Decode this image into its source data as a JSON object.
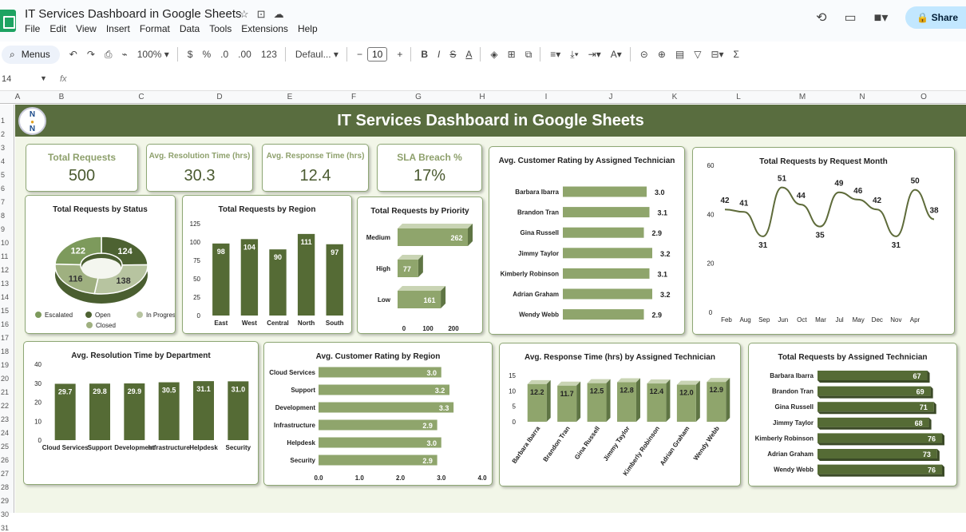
{
  "app": {
    "doc_title": "IT Services Dashboard in Google Sheets",
    "menu": [
      "File",
      "Edit",
      "View",
      "Insert",
      "Format",
      "Data",
      "Tools",
      "Extensions",
      "Help"
    ],
    "share_label": "Share",
    "name_box": "14",
    "fx_label": "fx"
  },
  "toolbar": {
    "menus_label": "Menus",
    "zoom": "100%",
    "currency": "$",
    "percent": "%",
    "dec_down": ".0",
    "dec_up": ".00",
    "number_format": "123",
    "font": "Defaul...",
    "font_size": "10"
  },
  "columns": [
    "A",
    "B",
    "C",
    "D",
    "E",
    "F",
    "G",
    "H",
    "I",
    "J",
    "K",
    "L",
    "M",
    "N",
    "O"
  ],
  "rows": [
    "1",
    "2",
    "3",
    "4",
    "5",
    "6",
    "7",
    "8",
    "9",
    "10",
    "11",
    "12",
    "13",
    "14",
    "15",
    "16",
    "17",
    "18",
    "19",
    "20",
    "21",
    "22",
    "23",
    "24",
    "25",
    "26",
    "27",
    "28",
    "29",
    "30",
    "31"
  ],
  "dashboard": {
    "title": "IT Services Dashboard in Google Sheets",
    "logo_letters": [
      "N",
      "●",
      "N"
    ],
    "colors": {
      "dark": "#556b35",
      "light": "#8fa56c",
      "pale": "#b9c69f",
      "banner": "#596d3f"
    },
    "kpis": [
      {
        "label": "Total Requests",
        "value": "500"
      },
      {
        "label": "Avg. Resolution Time (hrs)",
        "value": "30.3"
      },
      {
        "label": "Avg. Response Time (hrs)",
        "value": "12.4"
      },
      {
        "label": "SLA Breach %",
        "value": "17%"
      }
    ]
  },
  "chart_data": [
    {
      "id": "status",
      "type": "pie",
      "title": "Total Requests  by Status",
      "categories": [
        "Escalated",
        "Open",
        "In Progress",
        "Closed"
      ],
      "values": [
        122,
        124,
        138,
        116
      ],
      "colors": [
        "#7d9a5c",
        "#4d6232",
        "#b7c4a0",
        "#9fb080"
      ]
    },
    {
      "id": "region",
      "type": "bar",
      "title": "Total Requests  by Region",
      "categories": [
        "East",
        "West",
        "Central",
        "North",
        "South"
      ],
      "values": [
        98,
        104,
        90,
        111,
        97
      ],
      "ylim": [
        0,
        125
      ],
      "yticks": [
        0,
        25,
        50,
        75,
        100,
        125
      ]
    },
    {
      "id": "priority",
      "type": "bar",
      "title": "Total Requests  by Priority",
      "categories": [
        "Medium",
        "High",
        "Low"
      ],
      "values": [
        262,
        77,
        161
      ],
      "xticks": [
        0,
        100,
        200
      ],
      "orientation": "horizontal"
    },
    {
      "id": "rating_tech",
      "type": "bar",
      "title": "Avg. Customer Rating by Assigned Technician",
      "categories": [
        "Barbara Ibarra",
        "Brandon Tran",
        "Gina Russell",
        "Jimmy Taylor",
        "Kimberly Robinson",
        "Adrian Graham",
        "Wendy Webb"
      ],
      "values": [
        "3.0",
        "3.1",
        "2.9",
        "3.2",
        "3.1",
        "3.2",
        "2.9"
      ],
      "orientation": "horizontal"
    },
    {
      "id": "month",
      "type": "line",
      "title": "Total Requests by Request Month",
      "categories": [
        "Feb",
        "Aug",
        "Sep",
        "Jun",
        "Oct",
        "Mar",
        "Jul",
        "May",
        "Dec",
        "Nov",
        "Apr"
      ],
      "values": [
        42,
        41,
        31,
        51,
        44,
        35,
        49,
        46,
        42,
        31,
        50,
        38
      ],
      "ylim": [
        0,
        60
      ],
      "yticks": [
        0,
        20,
        40,
        60
      ]
    },
    {
      "id": "resolution_dept",
      "type": "bar",
      "title": "Avg. Resolution Time by Department",
      "categories": [
        "Cloud Services",
        "Support",
        "Development",
        "Infrastructure",
        "Helpdesk",
        "Security"
      ],
      "values": [
        "29.7",
        "29.8",
        "29.9",
        "30.5",
        "31.1",
        "31.0"
      ],
      "ylim": [
        0,
        40
      ],
      "yticks": [
        0,
        10,
        20,
        30,
        40
      ]
    },
    {
      "id": "rating_region",
      "type": "bar",
      "title": "Avg. Customer Rating by Region",
      "categories": [
        "Cloud Services",
        "Support",
        "Development",
        "Infrastructure",
        "Helpdesk",
        "Security"
      ],
      "values": [
        "3.0",
        "3.2",
        "3.3",
        "2.9",
        "3.0",
        "2.9"
      ],
      "xlim": [
        0,
        4
      ],
      "xticks": [
        "0.0",
        "1.0",
        "2.0",
        "3.0",
        "4.0"
      ],
      "orientation": "horizontal"
    },
    {
      "id": "response_tech",
      "type": "bar",
      "title": "Avg. Response Time (hrs)  by Assigned Technician",
      "categories": [
        "Barbara Ibarra",
        "Brandon Tran",
        "Gina Russell",
        "Jimmy Taylor",
        "Kimberly Robinson",
        "Adrian Graham",
        "Wendy Webb"
      ],
      "values": [
        "12.2",
        "11.7",
        "12.5",
        "12.8",
        "12.4",
        "12.0",
        "12.9"
      ],
      "ylim": [
        0,
        15
      ],
      "yticks": [
        0,
        5,
        10,
        15
      ]
    },
    {
      "id": "requests_tech",
      "type": "bar",
      "title": "Total Requests  by Assigned Technician",
      "categories": [
        "Barbara Ibarra",
        "Brandon Tran",
        "Gina Russell",
        "Jimmy Taylor",
        "Kimberly Robinson",
        "Adrian Graham",
        "Wendy Webb"
      ],
      "values": [
        67,
        69,
        71,
        68,
        76,
        73,
        76
      ],
      "orientation": "horizontal"
    }
  ]
}
